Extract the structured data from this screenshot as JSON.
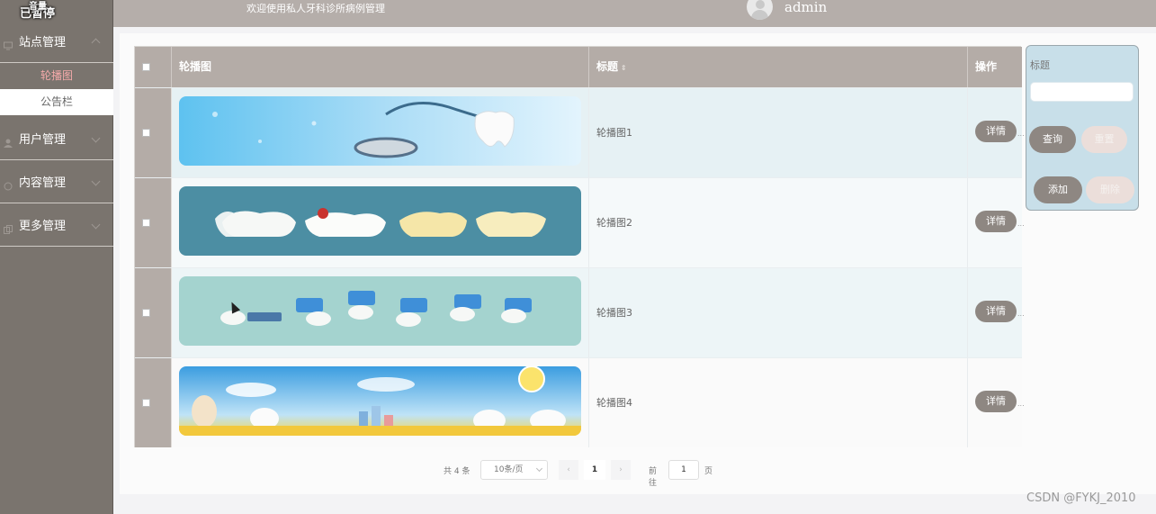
{
  "overlay": {
    "paused_text": "已暂停",
    "small_text": "音量"
  },
  "header": {
    "welcome": "欢迎使用私人牙科诊所病例管理",
    "username": "admin"
  },
  "sidebar": {
    "groups": [
      {
        "label": "站点管理"
      },
      {
        "label": "用户管理"
      },
      {
        "label": "内容管理"
      },
      {
        "label": "更多管理"
      }
    ],
    "sub_items": [
      {
        "label": "轮播图"
      },
      {
        "label": "公告栏"
      }
    ]
  },
  "table": {
    "headers": {
      "image": "轮播图",
      "title": "标题",
      "sort_symbol": "⇕",
      "operation": "操作"
    },
    "rows": [
      {
        "title": "轮播图1",
        "detail": "详情",
        "more": "..."
      },
      {
        "title": "轮播图2",
        "detail": "详情",
        "more": "..."
      },
      {
        "title": "轮播图3",
        "detail": "详情",
        "more": "..."
      },
      {
        "title": "轮播图4",
        "detail": "详情",
        "more": "..."
      }
    ]
  },
  "search": {
    "label": "标题",
    "input_value": "",
    "query_button": "查询",
    "reset_button": "重置",
    "add_button": "添加",
    "delete_button": "删除"
  },
  "pagination": {
    "total": "共 4 条",
    "page_size": "10条/页",
    "current_page": "1",
    "goto_label": "前往",
    "goto_value": "1",
    "page_unit": "页",
    "prev": "‹",
    "next": "›"
  },
  "watermark": "CSDN @FYKJ_2010",
  "colors": {
    "sidebar": "#7a746e",
    "header": "#b5aeaa",
    "button": "#8e8782",
    "search_panel": "#c8dfe9",
    "active_submenu_text": "#f3a9a9"
  }
}
